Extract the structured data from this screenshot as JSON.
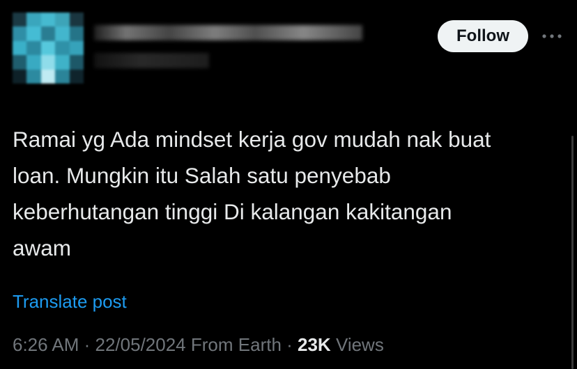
{
  "header": {
    "follow_label": "Follow",
    "more_icon": "more-horizontal-icon"
  },
  "tweet": {
    "text": "Ramai yg Ada mindset kerja gov mudah nak buat\nloan. Mungkin itu Salah satu penyebab\nkeberhutangan tinggi Di kalangan kakitangan\nawam",
    "translate_label": "Translate post"
  },
  "meta": {
    "time": "6:26 AM",
    "separator1": " · ",
    "date": "22/05/2024",
    "source": " From Earth",
    "separator2": " · ",
    "views_count": "23K",
    "views_label": " Views"
  },
  "colors": {
    "background": "#000000",
    "text_primary": "#e7e9ea",
    "text_secondary": "#71767b",
    "link": "#1d9bf0",
    "follow_bg": "#eff3f4",
    "follow_text": "#0f1419"
  }
}
